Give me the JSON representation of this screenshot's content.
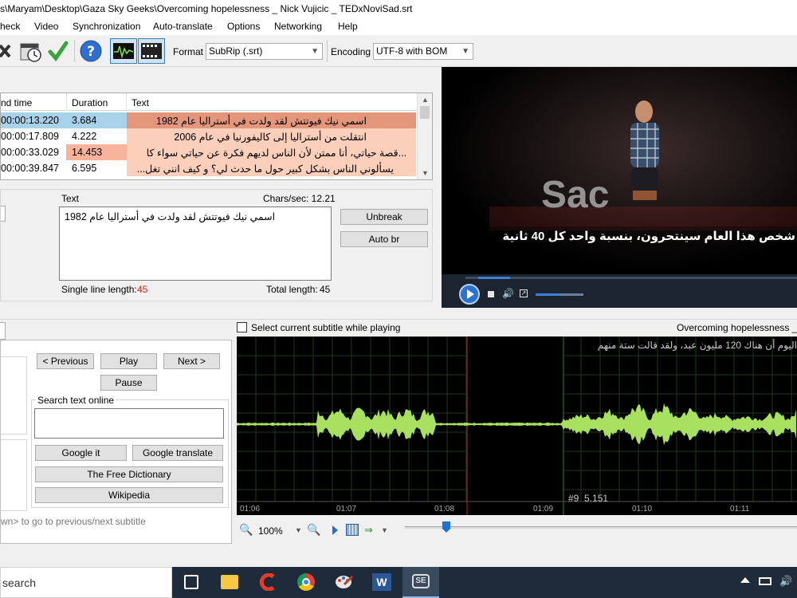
{
  "window": {
    "title": "s\\Maryam\\Desktop\\Gaza Sky Geeks\\Overcoming hopelessness _ Nick Vujicic _ TEDxNoviSad.srt"
  },
  "menu": [
    "heck",
    "Video",
    "Synchronization",
    "Auto-translate",
    "Options",
    "Networking",
    "Help"
  ],
  "toolbar": {
    "format_label": "Format",
    "format_value": "SubRip (.srt)",
    "encoding_label": "Encoding",
    "encoding_value": "UTF-8 with BOM"
  },
  "grid": {
    "headers": {
      "end_time": "nd time",
      "duration": "Duration",
      "text": "Text"
    },
    "rows": [
      {
        "end": "00:00:13.220",
        "duration": "3.684",
        "text": "اسمي نيك فيوتتش لقد ولدت في أستراليا عام 1982"
      },
      {
        "end": "00:00:17.809",
        "duration": "4.222",
        "text": "انتقلت من أستراليا إلى كاليفورنيا في عام 2006"
      },
      {
        "end": "00:00:33.029",
        "duration": "14.453",
        "text": "...قصة حياتي، أنا ممتن لأن الناس لديهم فكرة عن حياتي سواء كا"
      },
      {
        "end": "00:00:39.847",
        "duration": "6.595",
        "text": "يسألوني الناس بشكل كبير حول ما حدث لي؟ و كيف انني تغل..."
      }
    ]
  },
  "editor": {
    "text_label": "Text",
    "chars_sec": "Chars/sec: 12.21",
    "text_value": "اسمي نيك فيوتتش لقد ولدت في أستراليا عام 1982",
    "single_line_label": "Single line length:",
    "single_line_value": "45",
    "total_length_label": "Total length:",
    "total_length_value": "45",
    "unbreak": "Unbreak",
    "auto_br": "Auto br"
  },
  "video": {
    "subtitle": "شخص هذا العام سينتحرون، بنسبة واحد كل 40 ثانية"
  },
  "waveform_bar": {
    "select_label": "Select current subtitle while playing",
    "filename": "Overcoming hopelessness _ N"
  },
  "nav": {
    "previous": "< Previous",
    "play": "Play",
    "next": "Next >",
    "pause": "Pause",
    "search_online": "Search text online",
    "google_it": "Google it",
    "google_translate": "Google translate",
    "free_dictionary": "The Free Dictionary",
    "wikipedia": "Wikipedia",
    "hint": "wn> to go to previous/next subtitle"
  },
  "waveform": {
    "subtitle_text": "اليوم أن هناك 120 مليون عبد، ولقد قالت ستة منهم",
    "segment_info": "#9  5.151",
    "ticks": [
      "01:06",
      "01:07",
      "01:08",
      "01:09",
      "01:10",
      "01:11"
    ],
    "zoom": "100%"
  },
  "taskbar": {
    "search": "search"
  }
}
